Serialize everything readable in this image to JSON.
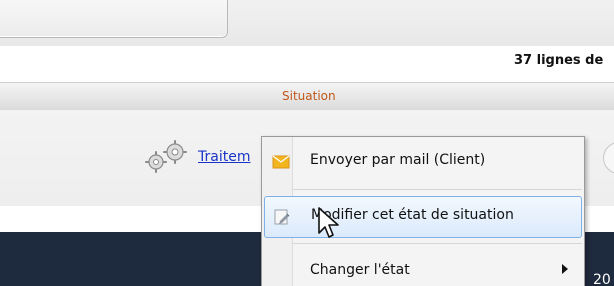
{
  "status": {
    "row_count": "37 lignes de"
  },
  "table": {
    "column_header": "Situation",
    "link_text": "Traitem"
  },
  "context_menu": {
    "items": [
      {
        "label": "Envoyer par mail (Client)",
        "icon": "envelope-icon"
      },
      {
        "label": "Modifier cet état de situation",
        "icon": "edit-icon"
      },
      {
        "label": "Changer l'état",
        "icon": "",
        "has_submenu": true
      }
    ]
  },
  "footer": {
    "partial_text": "20"
  },
  "colors": {
    "link": "#1a34c8",
    "header_text": "#c0581a",
    "menu_highlight": "#dbeafb",
    "dark_band": "#1e2a3d"
  }
}
